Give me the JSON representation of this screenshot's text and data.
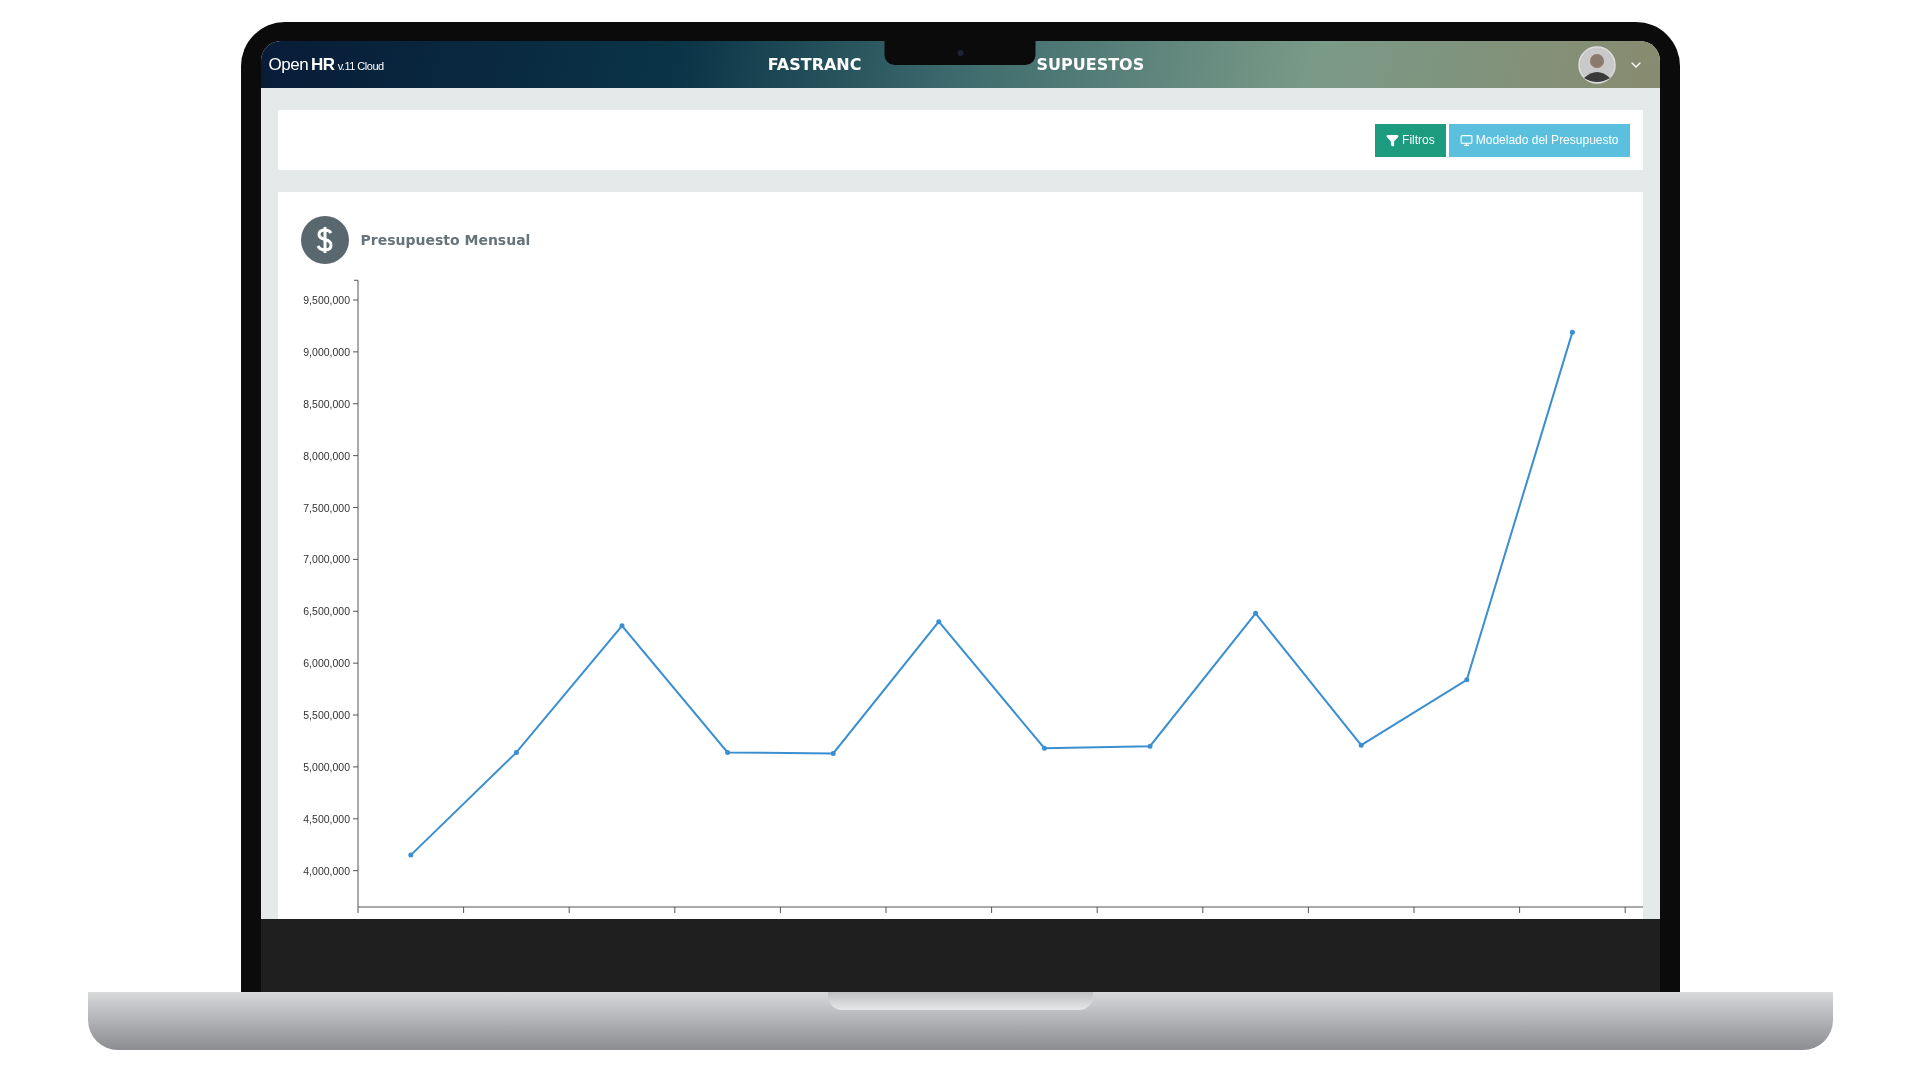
{
  "header": {
    "logo_brand": "Open",
    "logo_product": "HR",
    "logo_version": "v.11 Cloud",
    "title_left": "FASTRANC",
    "title_right": "SUPUESTOS"
  },
  "toolbar": {
    "buttons": [
      {
        "label": "Filtros",
        "kind": "filter"
      },
      {
        "label": "Modelado del Presupuesto",
        "kind": "monitor"
      }
    ]
  },
  "panel": {
    "title": "Presupuesto Mensual",
    "chart_data": {
      "type": "line",
      "ylim": [
        3650000,
        9690000
      ],
      "yticks": [
        {
          "value": 4000000,
          "label": "4,000,000"
        },
        {
          "value": 4500000,
          "label": "4,500,000"
        },
        {
          "value": 5000000,
          "label": "5,000,000"
        },
        {
          "value": 5500000,
          "label": "5,500,000"
        },
        {
          "value": 6000000,
          "label": "6,000,000"
        },
        {
          "value": 6500000,
          "label": "6,500,000"
        },
        {
          "value": 7000000,
          "label": "7,000,000"
        },
        {
          "value": 7500000,
          "label": "7,500,000"
        },
        {
          "value": 8000000,
          "label": "8,000,000"
        },
        {
          "value": 8500000,
          "label": "8,500,000"
        },
        {
          "value": 9000000,
          "label": "9,000,000"
        },
        {
          "value": 9500000,
          "label": "9,500,000"
        }
      ],
      "series": [
        {
          "color": "#3b8fd0",
          "values": [
            4150000,
            5140000,
            6360000,
            5140000,
            5130000,
            6400000,
            5180000,
            5200000,
            6480000,
            5210000,
            5840000,
            9190000
          ]
        }
      ]
    }
  }
}
